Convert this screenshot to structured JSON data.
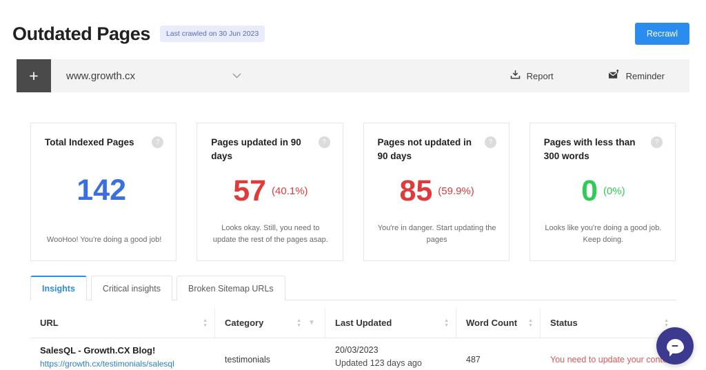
{
  "header": {
    "title": "Outdated Pages",
    "crawl_badge": "Last crawled on 30 Jun 2023",
    "recrawl_label": "Recrawl"
  },
  "toolbar": {
    "add_label": "+",
    "domain": "www.growth.cx",
    "chevron": "⌄",
    "actions": [
      {
        "label": "Report",
        "icon": "download-icon"
      },
      {
        "label": "Reminder",
        "icon": "mail-reminder-icon"
      }
    ]
  },
  "cards": [
    {
      "title": "Total Indexed Pages",
      "value": "142",
      "pct": "",
      "color": "#3a6fe0",
      "note": "WooHoo! You're doing a good job!",
      "help": "?"
    },
    {
      "title": "Pages updated in 90 days",
      "value": "57",
      "pct": "(40.1%)",
      "color": "#e03a3a",
      "note": "Looks okay. Still, you need to update the rest of the pages asap.",
      "help": "?"
    },
    {
      "title": "Pages not updated in 90 days",
      "value": "85",
      "pct": "(59.9%)",
      "color": "#e03a3a",
      "note": "You're in danger. Start updating the pages",
      "help": "?"
    },
    {
      "title": "Pages with less than 300 words",
      "value": "0",
      "pct": "(0%)",
      "color": "#2ecc55",
      "note": "Looks like you're doing a good job. Keep doing.",
      "help": "?"
    }
  ],
  "tabs": [
    {
      "label": "Insights",
      "active": true
    },
    {
      "label": "Critical insights",
      "active": false
    },
    {
      "label": "Broken Sitemap URLs",
      "active": false
    }
  ],
  "table": {
    "columns": [
      "URL",
      "Category",
      "Last Updated",
      "Word Count",
      "Status"
    ],
    "rows": [
      {
        "title": "SalesQL - Growth.CX Blog!",
        "url": "https://growth.cx/testimonials/salesql",
        "category": "testimonials",
        "date": "20/03/2023",
        "ago": "Updated 123 days ago",
        "word_count": "487",
        "status": "You need to update your content"
      }
    ]
  },
  "chat": {
    "name": "chat-widget"
  }
}
